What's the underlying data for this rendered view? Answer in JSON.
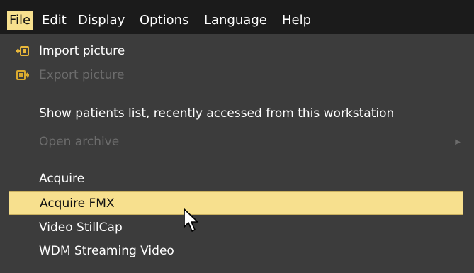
{
  "menubar": {
    "items": [
      "File",
      "Edit",
      "Display",
      "Options",
      "Language",
      "Help"
    ],
    "active": "File"
  },
  "file_menu": {
    "import_picture": {
      "label": "Import picture",
      "icon": "import-picture-icon"
    },
    "export_picture": {
      "label": "Export picture",
      "icon": "export-picture-icon",
      "enabled": false
    },
    "show_patients_list": {
      "label": "Show patients list, recently accessed from this workstation"
    },
    "open_archive": {
      "label": "Open archive",
      "enabled": false,
      "has_submenu": true
    },
    "acquire": {
      "label": "Acquire"
    },
    "acquire_fmx": {
      "label": "Acquire FMX",
      "highlighted": true
    },
    "video_stillcap": {
      "label": "Video StillCap"
    },
    "wdm_streaming_video": {
      "label": "WDM Streaming Video"
    }
  },
  "colors": {
    "menubar_bg": "#1b1b1b",
    "menu_bg": "#3c3c3c",
    "highlight": "#f7e08e",
    "disabled_text": "#6c6c6c",
    "icon_accent": "#e8b73a"
  }
}
